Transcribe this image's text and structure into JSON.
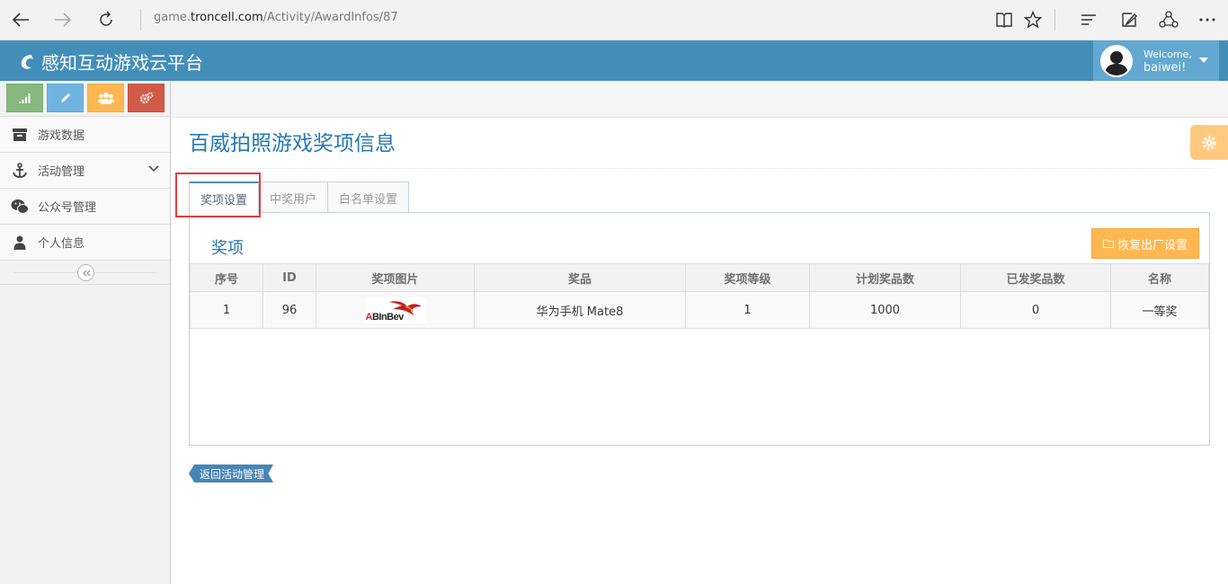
{
  "browser": {
    "url_prefix": "game.",
    "url_host": "troncell.com",
    "url_path": "/Activity/AwardInfos/87"
  },
  "header": {
    "logo_text": "感知互动游戏云平台",
    "welcome": "Welcome,",
    "username": "baiwei!"
  },
  "sidebar": {
    "items": [
      {
        "label": "游戏数据",
        "icon": "archive-icon"
      },
      {
        "label": "活动管理",
        "icon": "anchor-icon"
      },
      {
        "label": "公众号管理",
        "icon": "wechat-icon"
      },
      {
        "label": "个人信息",
        "icon": "user-icon"
      }
    ]
  },
  "page": {
    "title": "百威拍照游戏奖项信息"
  },
  "tabs": [
    {
      "label": "奖项设置",
      "active": true
    },
    {
      "label": "中奖用户",
      "active": false
    },
    {
      "label": "白名单设置",
      "active": false
    }
  ],
  "section": {
    "title": "奖项",
    "reset_label": "恢复出厂设置"
  },
  "table": {
    "headers": [
      "序号",
      "ID",
      "奖项图片",
      "奖品",
      "奖项等级",
      "计划奖品数",
      "已发奖品数",
      "名称"
    ],
    "rows": [
      {
        "index": "1",
        "id": "96",
        "image_text_a": "A",
        "image_text_b": "B",
        "image_text_rest": "InBev",
        "prize": "华为手机 Mate8",
        "level": "1",
        "planned": "1000",
        "issued": "0",
        "name": "一等奖"
      }
    ]
  },
  "back_label": "返回活动管理",
  "colors": {
    "header_bg": "#438eb9",
    "accent": "#2679b5",
    "highlight": "#e23b3b"
  }
}
